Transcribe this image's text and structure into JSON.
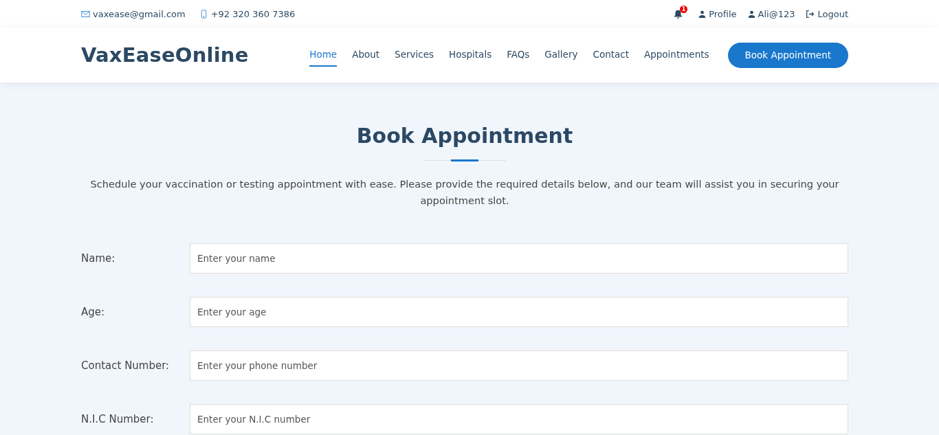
{
  "topbar": {
    "email": "vaxease@gmail.com",
    "phone": "+92 320 360 7386",
    "notification_count": "1",
    "links": [
      {
        "kind": "profile",
        "label": "Profile"
      },
      {
        "kind": "user",
        "label": "Ali@123"
      },
      {
        "kind": "logout",
        "label": "Logout"
      }
    ]
  },
  "header": {
    "logo": "VaxEaseOnline",
    "nav": [
      {
        "label": "Home",
        "selected": true
      },
      {
        "label": "About",
        "selected": false
      },
      {
        "label": "Services",
        "selected": false
      },
      {
        "label": "Hospitals",
        "selected": false
      },
      {
        "label": "FAQs",
        "selected": false
      },
      {
        "label": "Gallery",
        "selected": false
      },
      {
        "label": "Contact",
        "selected": false
      },
      {
        "label": "Appointments",
        "selected": false
      }
    ],
    "cta": "Book Appointment"
  },
  "section": {
    "title": "Book Appointment",
    "description": "Schedule your vaccination or testing appointment with ease. Please provide the required details below, and our team will assist you in securing your appointment slot."
  },
  "form": {
    "fields": [
      {
        "label": "Name:",
        "placeholder": "Enter your name"
      },
      {
        "label": "Age:",
        "placeholder": "Enter your age"
      },
      {
        "label": "Contact Number:",
        "placeholder": "Enter your phone number"
      },
      {
        "label": "N.I.C Number:",
        "placeholder": "Enter your N.I.C number"
      }
    ]
  }
}
